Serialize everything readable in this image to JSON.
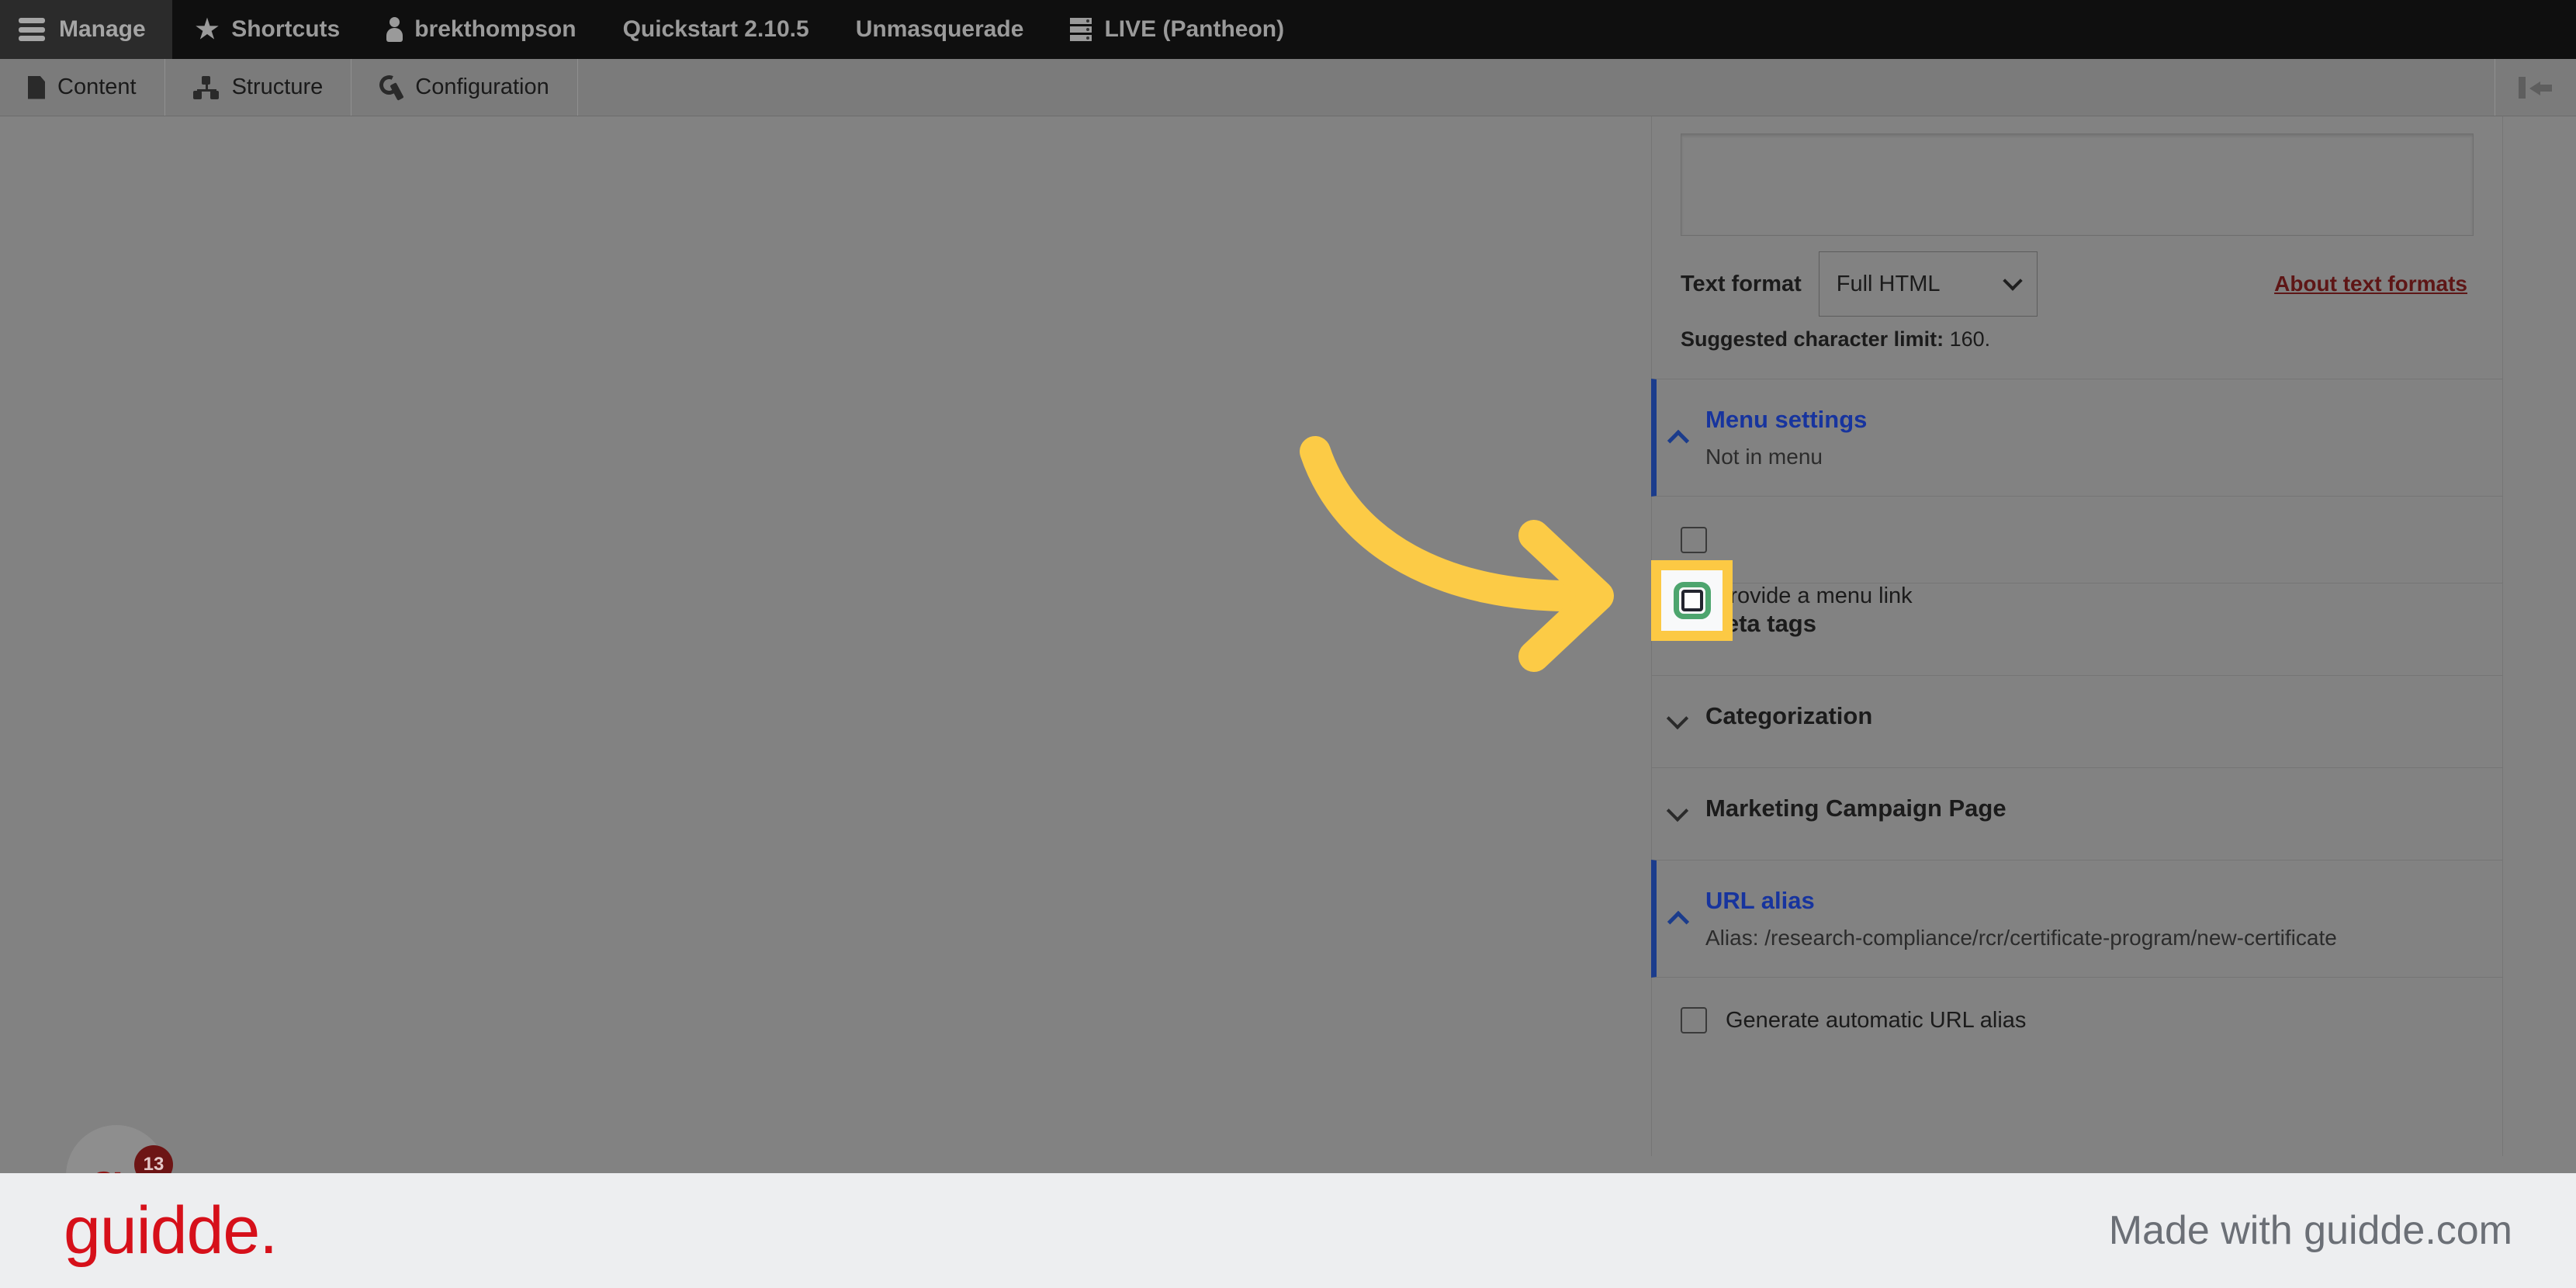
{
  "admin_toolbar": {
    "manage": {
      "label": "Manage",
      "icon": "hamburger-icon"
    },
    "items": [
      {
        "label": "Shortcuts",
        "icon": "star-icon"
      },
      {
        "label": "brekthompson",
        "icon": "person-icon"
      },
      {
        "label": "Quickstart 2.10.5",
        "icon": "none"
      },
      {
        "label": "Unmasquerade",
        "icon": "none"
      },
      {
        "label": "LIVE (Pantheon)",
        "icon": "server-icon"
      }
    ]
  },
  "admin_subbar": {
    "items": [
      {
        "label": "Content",
        "icon": "document-icon"
      },
      {
        "label": "Structure",
        "icon": "sitemap-icon"
      },
      {
        "label": "Configuration",
        "icon": "wrench-icon"
      }
    ],
    "collapse_icon": "collapse-sidebar-icon"
  },
  "form": {
    "summary_textarea_value": "",
    "text_format": {
      "label": "Text format",
      "value": "Full HTML",
      "chevron": "chevron-down-icon",
      "about_link": "About text formats"
    },
    "char_limit_label": "Suggested character limit:",
    "char_limit_value": "160.",
    "sections": [
      {
        "title": "Menu settings",
        "subtitle": "Not in menu",
        "open": true,
        "chevron": "chevron-up-icon"
      },
      {
        "title": "Meta tags",
        "subtitle": "",
        "open": false,
        "chevron": "chevron-down-icon"
      },
      {
        "title": "Categorization",
        "subtitle": "",
        "open": false,
        "chevron": "chevron-down-icon"
      },
      {
        "title": "Marketing Campaign Page",
        "subtitle": "",
        "open": false,
        "chevron": "chevron-down-icon"
      },
      {
        "title": "URL alias",
        "subtitle": "Alias: /research-compliance/rcr/certificate-program/new-certificate",
        "open": true,
        "chevron": "chevron-up-icon"
      }
    ],
    "provide_menu_link": {
      "label": "Provide a menu link",
      "checked": false,
      "highlighted": true
    },
    "generate_alias": {
      "label": "Generate automatic URL alias",
      "checked": false
    }
  },
  "annotation": {
    "arrow_color": "#fccb46",
    "highlight_outer_color": "#fcc944",
    "highlight_ring_color": "#4da56e"
  },
  "watermark": {
    "badge_letter": "g",
    "badge_count": "13"
  },
  "footer": {
    "logo": "guidde.",
    "made_with": "Made with guidde.com",
    "logo_color": "#d6101a"
  }
}
